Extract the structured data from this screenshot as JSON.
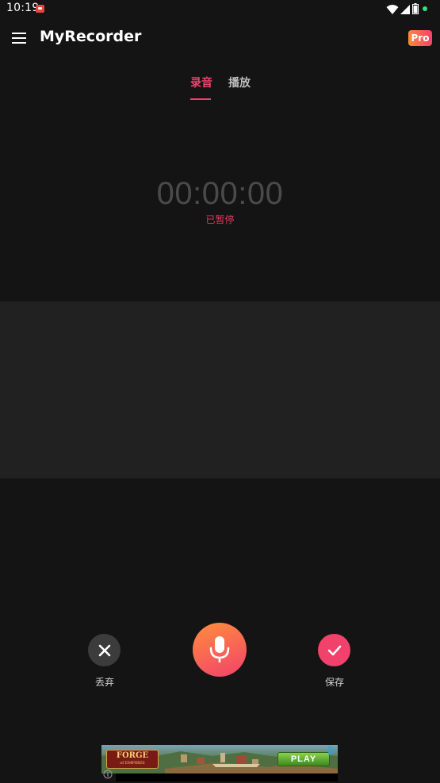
{
  "status_bar": {
    "time": "10:19"
  },
  "app_bar": {
    "title": "MyRecorder",
    "pro_badge": "Pro"
  },
  "tabs": [
    {
      "label": "录音",
      "active": true
    },
    {
      "label": "播放",
      "active": false
    }
  ],
  "recorder": {
    "elapsed": "00:00:00",
    "state_label": "已暂停"
  },
  "controls": {
    "discard_label": "丢弃",
    "save_label": "保存"
  },
  "ad": {
    "logo_main": "FORGE",
    "logo_sub": "of EMPIRES",
    "cta": "PLAY"
  },
  "colors": {
    "background": "#141414",
    "panel": "#212121",
    "accent": "#f2416b",
    "accent_orange": "#ff8e3c",
    "timer": "#4a4a4a"
  },
  "icons": {
    "menu": "menu-icon",
    "discard": "close-icon",
    "record": "microphone-icon",
    "save": "check-icon"
  }
}
